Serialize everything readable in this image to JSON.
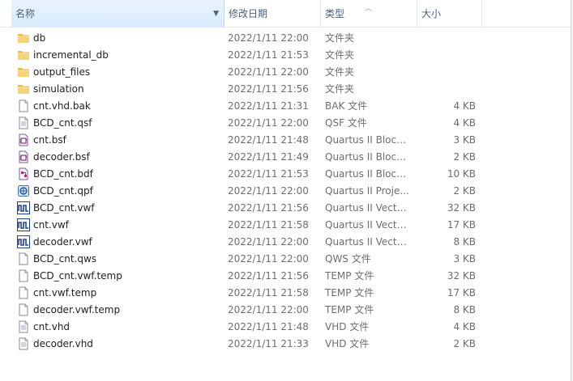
{
  "header": {
    "name": "名称",
    "date": "修改日期",
    "type": "类型",
    "size": "大小"
  },
  "files": [
    {
      "name": "db",
      "date": "2022/1/11 22:00",
      "type": "文件夹",
      "size": "",
      "icon": "folder-icon"
    },
    {
      "name": "incremental_db",
      "date": "2022/1/11 21:53",
      "type": "文件夹",
      "size": "",
      "icon": "folder-icon"
    },
    {
      "name": "output_files",
      "date": "2022/1/11 22:00",
      "type": "文件夹",
      "size": "",
      "icon": "folder-icon"
    },
    {
      "name": "simulation",
      "date": "2022/1/11 21:56",
      "type": "文件夹",
      "size": "",
      "icon": "folder-icon"
    },
    {
      "name": "cnt.vhd.bak",
      "date": "2022/1/11 21:31",
      "type": "BAK 文件",
      "size": "4 KB",
      "icon": "file-icon"
    },
    {
      "name": "BCD_cnt.qsf",
      "date": "2022/1/11 22:00",
      "type": "QSF 文件",
      "size": "4 KB",
      "icon": "text-file-icon"
    },
    {
      "name": "cnt.bsf",
      "date": "2022/1/11 21:48",
      "type": "Quartus II Block...",
      "size": "3 KB",
      "icon": "block-symbol-icon"
    },
    {
      "name": "decoder.bsf",
      "date": "2022/1/11 21:49",
      "type": "Quartus II Block...",
      "size": "2 KB",
      "icon": "block-symbol-icon"
    },
    {
      "name": "BCD_cnt.bdf",
      "date": "2022/1/11 21:53",
      "type": "Quartus II Block...",
      "size": "10 KB",
      "icon": "block-diagram-icon"
    },
    {
      "name": "BCD_cnt.qpf",
      "date": "2022/1/11 22:00",
      "type": "Quartus II Proje...",
      "size": "2 KB",
      "icon": "project-icon"
    },
    {
      "name": "BCD_cnt.vwf",
      "date": "2022/1/11 21:56",
      "type": "Quartus II Vecto...",
      "size": "32 KB",
      "icon": "waveform-icon"
    },
    {
      "name": "cnt.vwf",
      "date": "2022/1/11 21:58",
      "type": "Quartus II Vecto...",
      "size": "17 KB",
      "icon": "waveform-icon"
    },
    {
      "name": "decoder.vwf",
      "date": "2022/1/11 22:00",
      "type": "Quartus II Vecto...",
      "size": "8 KB",
      "icon": "waveform-icon"
    },
    {
      "name": "BCD_cnt.qws",
      "date": "2022/1/11 22:00",
      "type": "QWS 文件",
      "size": "3 KB",
      "icon": "file-icon"
    },
    {
      "name": "BCD_cnt.vwf.temp",
      "date": "2022/1/11 21:56",
      "type": "TEMP 文件",
      "size": "32 KB",
      "icon": "file-icon"
    },
    {
      "name": "cnt.vwf.temp",
      "date": "2022/1/11 21:58",
      "type": "TEMP 文件",
      "size": "17 KB",
      "icon": "file-icon"
    },
    {
      "name": "decoder.vwf.temp",
      "date": "2022/1/11 22:00",
      "type": "TEMP 文件",
      "size": "8 KB",
      "icon": "file-icon"
    },
    {
      "name": "cnt.vhd",
      "date": "2022/1/11 21:48",
      "type": "VHD 文件",
      "size": "4 KB",
      "icon": "text-file-icon"
    },
    {
      "name": "decoder.vhd",
      "date": "2022/1/11 21:33",
      "type": "VHD 文件",
      "size": "2 KB",
      "icon": "text-file-icon"
    }
  ]
}
